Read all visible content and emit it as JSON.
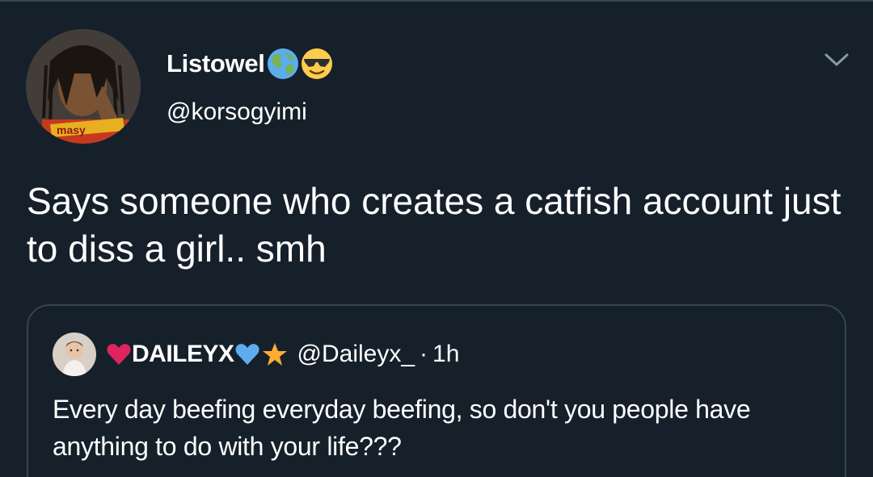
{
  "tweet": {
    "display_name": "Listowel",
    "name_emojis": [
      "globe-icon",
      "sunglasses-emoji-icon"
    ],
    "handle": "@korsogyimi",
    "text": "Says someone who creates a catfish account just to diss a girl.. smh",
    "menu_icon": "chevron-down-icon"
  },
  "quote": {
    "display_name": "DAILEYX",
    "name_icons": [
      "red-heart-icon",
      "blue-heart-icon",
      "star-icon"
    ],
    "handle": "@Daileyx_",
    "separator": "·",
    "time": "1h",
    "text": "Every day beefing everyday beefing, so don't you people have anything to do with your life???"
  },
  "colors": {
    "background": "#15202b",
    "border": "#38444d",
    "text": "#ffffff",
    "chevron": "#8899a6",
    "red_heart": "#e0245e",
    "blue_heart": "#5dadec",
    "star": "#ffac33"
  }
}
